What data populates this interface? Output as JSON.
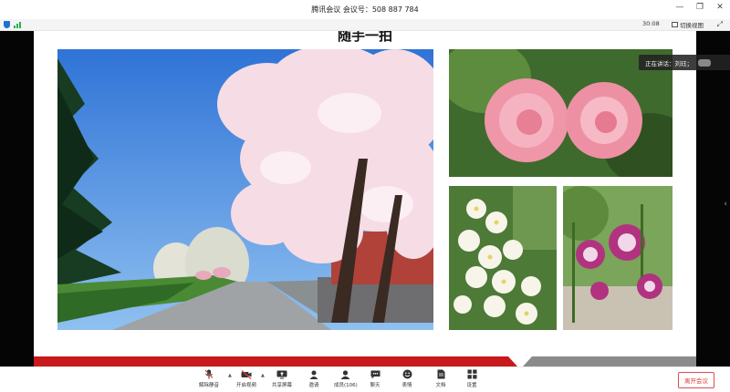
{
  "window": {
    "title": "腾讯会议 会议号：508 887 784",
    "controls": [
      "—",
      "❐",
      "✕"
    ]
  },
  "status": {
    "timer": "30:08",
    "switch_view": "切换视图"
  },
  "slide": {
    "title": "随手一拍"
  },
  "overlay": {
    "speaking": "正在讲话：刘珏；"
  },
  "toolbar": {
    "items": [
      {
        "label": "解除静音",
        "icon": "mic-muted-icon"
      },
      {
        "label": "开启视频",
        "icon": "camera-off-icon"
      },
      {
        "label": "共享屏幕",
        "icon": "screen-share-icon"
      },
      {
        "label": "邀请",
        "icon": "invite-icon"
      },
      {
        "label": "成员(106)",
        "icon": "members-icon"
      },
      {
        "label": "聊天",
        "icon": "chat-icon"
      },
      {
        "label": "表情",
        "icon": "emoji-icon"
      },
      {
        "label": "文档",
        "icon": "document-icon"
      },
      {
        "label": "设置",
        "icon": "settings-icon"
      }
    ],
    "leave": "离开会议"
  },
  "colors": {
    "accent_red": "#c8191d",
    "leave_red": "#d83b3b",
    "signal_green": "#2bb24c",
    "brand_blue": "#1f6fd6"
  }
}
